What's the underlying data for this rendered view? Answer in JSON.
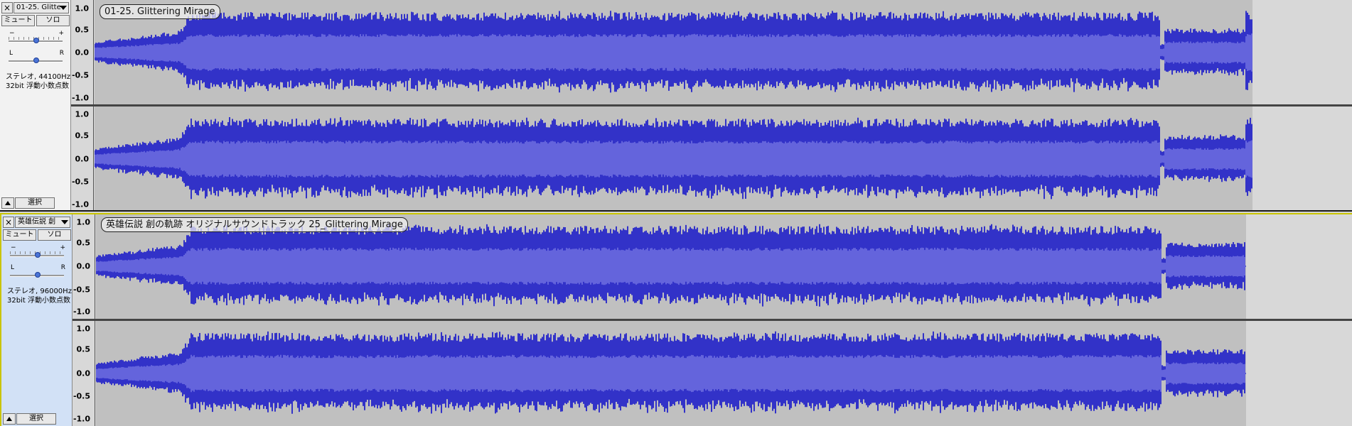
{
  "tracks": [
    {
      "name": "01-25. Glitte",
      "clip_label": "01-25. Glittering Mirage",
      "mute_label": "ミュート",
      "solo_label": "ソロ",
      "gain": {
        "minus": "−",
        "plus": "+",
        "value": 0.5
      },
      "pan": {
        "left": "L",
        "right": "R",
        "value": 0.5
      },
      "info_line1": "ステレオ, 44100Hz",
      "info_line2": "32bit 浮動小数点数",
      "select_label": "選択",
      "scale_labels": [
        "1.0",
        "0.5",
        "0.0",
        "-0.5",
        "-1.0"
      ]
    },
    {
      "name": "英雄伝説 創",
      "clip_label": "英雄伝説 創の軌跡 オリジナルサウンドトラック 25_Glittering Mirage",
      "mute_label": "ミュート",
      "solo_label": "ソロ",
      "gain": {
        "minus": "−",
        "plus": "+",
        "value": 0.5
      },
      "pan": {
        "left": "L",
        "right": "R",
        "value": 0.5
      },
      "info_line1": "ステレオ, 96000Hz",
      "info_line2": "32bit 浮動小数点数",
      "select_label": "選択",
      "scale_labels": [
        "1.0",
        "0.5",
        "0.0",
        "-0.5",
        "-1.0"
      ]
    }
  ],
  "colors": {
    "waveform_peak": "#3232c8",
    "waveform_rms": "#6464dc",
    "background": "#c0c0c0",
    "selected_track_border": "#c9c400"
  }
}
